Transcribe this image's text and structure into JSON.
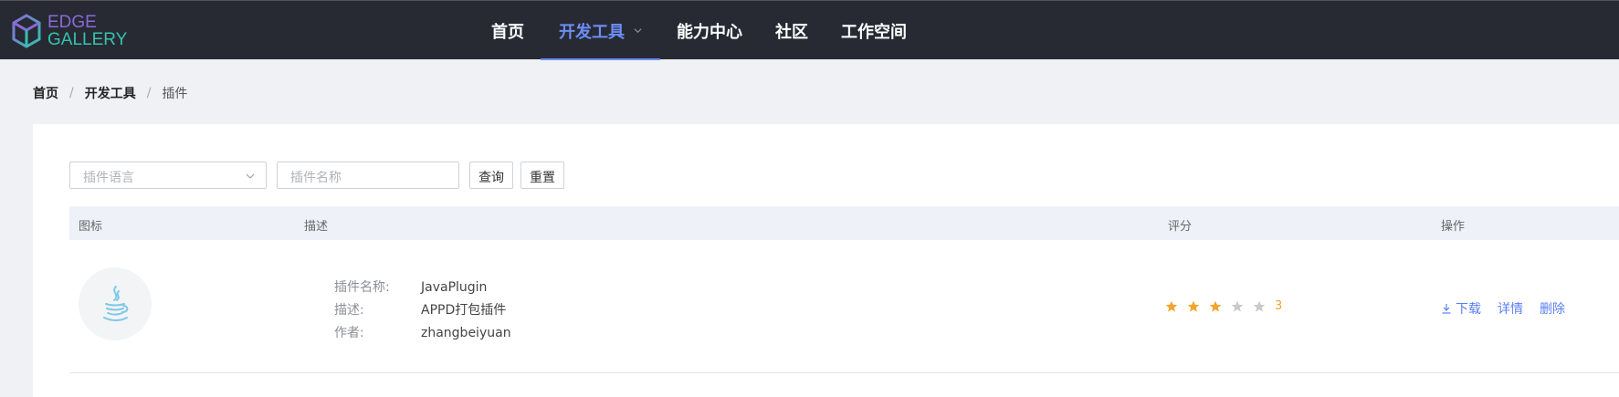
{
  "brand": {
    "line1": "EDGE",
    "line2": "GALLERY"
  },
  "nav": {
    "items": [
      "首页",
      "开发工具",
      "能力中心",
      "社区",
      "工作空间"
    ],
    "active_index": 1
  },
  "breadcrumb": [
    "首页",
    "开发工具",
    "插件"
  ],
  "filters": {
    "language_placeholder": "插件语言",
    "name_placeholder": "插件名称",
    "query_label": "查询",
    "reset_label": "重置"
  },
  "table": {
    "columns": [
      "图标",
      "描述",
      "评分",
      "操作"
    ],
    "rows": [
      {
        "icon": "java-icon",
        "name_label": "插件名称:",
        "name": "JavaPlugin",
        "desc_label": "描述:",
        "desc": "APPD打包插件",
        "author_label": "作者:",
        "author": "zhangbeiyuan",
        "rating": 3,
        "rating_max": 5,
        "rating_text": "3",
        "actions": {
          "download": "下载",
          "detail": "详情",
          "delete": "删除"
        }
      }
    ]
  },
  "colors": {
    "accent": "#6d8ef7",
    "topbar": "#272a33",
    "star_on": "#f3a42d",
    "star_off": "#c8cacf",
    "link": "#5a7ef5"
  }
}
